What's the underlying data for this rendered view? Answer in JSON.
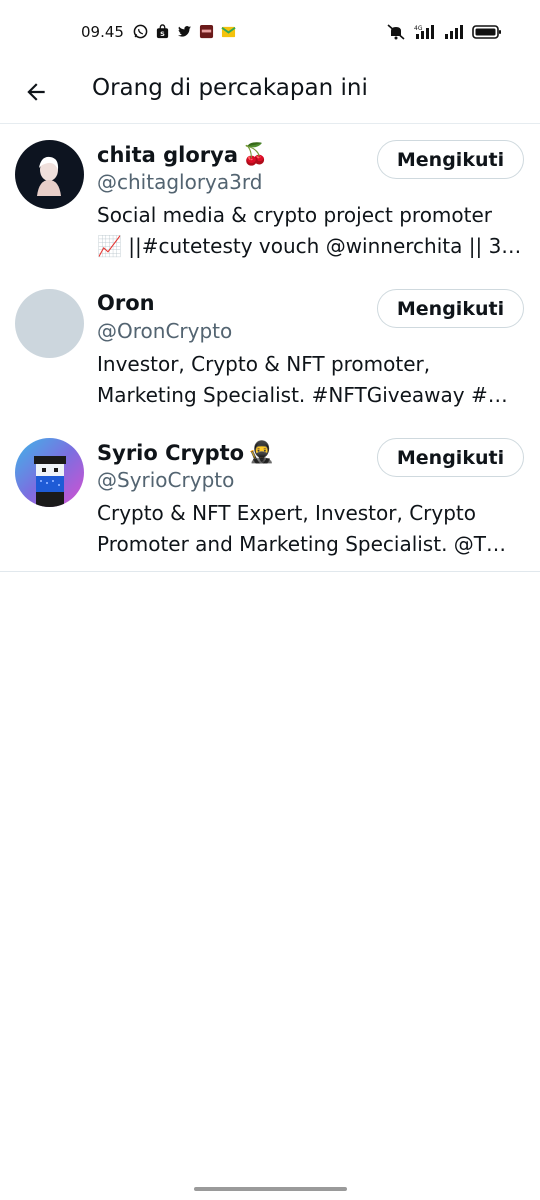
{
  "status_bar": {
    "time": "09.45",
    "notification_icons": [
      "whatsapp-icon",
      "shopee-icon",
      "twitter-icon",
      "app-icon",
      "gmail-icon"
    ],
    "system_icons": [
      "mute-icon",
      "signal-4g-icon",
      "signal-icon",
      "battery-icon"
    ]
  },
  "header": {
    "title": "Orang di percakapan ini"
  },
  "people": [
    {
      "name": "chita glorya",
      "name_emoji": "🍒",
      "handle": "@chitaglorya3rd",
      "bio_line1": "Social media & crypto project promoter",
      "bio_line2": "📈 ||#cutetesty vouch @winnerchita || 3…",
      "follow_label": "Mengikuti"
    },
    {
      "name": "Oron",
      "name_emoji": "",
      "handle": "@OronCrypto",
      "bio_line1": "Investor, Crypto & NFT promoter,",
      "bio_line2": "Marketing Specialist. #NFTGiveaway #…",
      "follow_label": "Mengikuti"
    },
    {
      "name": "Syrio Crypto",
      "name_emoji": "🥷",
      "handle": "@SyrioCrypto",
      "bio_line1": "Crypto & NFT Expert, Investor, Crypto",
      "bio_line2": "Promoter and Marketing Specialist. @T…",
      "follow_label": "Mengikuti"
    }
  ],
  "colors": {
    "text": "#0f1419",
    "secondary": "#536471",
    "border": "#cfd9de",
    "divider": "#e1e8ed"
  }
}
